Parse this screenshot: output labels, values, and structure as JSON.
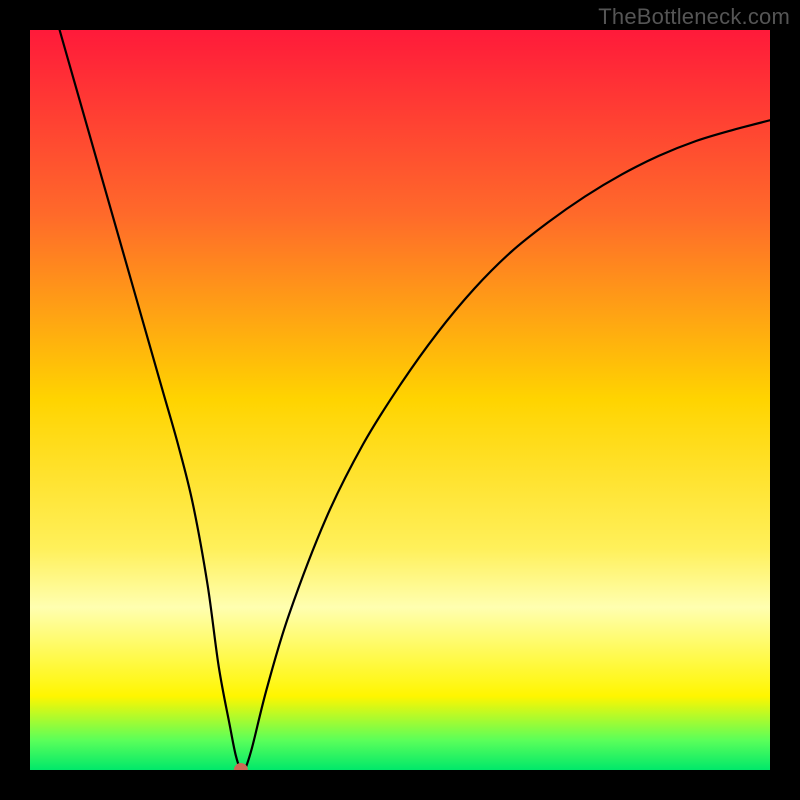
{
  "watermark": "TheBottleneck.com",
  "chart_data": {
    "type": "line",
    "title": "",
    "xlabel": "",
    "ylabel": "",
    "xlim": [
      0,
      100
    ],
    "ylim": [
      0,
      100
    ],
    "gradient_stops": [
      {
        "offset": 0,
        "color": "#ff1a3a"
      },
      {
        "offset": 0.25,
        "color": "#ff6a2a"
      },
      {
        "offset": 0.5,
        "color": "#ffd400"
      },
      {
        "offset": 0.7,
        "color": "#fff05a"
      },
      {
        "offset": 0.78,
        "color": "#ffffb0"
      },
      {
        "offset": 0.9,
        "color": "#fff600"
      },
      {
        "offset": 0.96,
        "color": "#5aff5a"
      },
      {
        "offset": 1.0,
        "color": "#00e86a"
      }
    ],
    "series": [
      {
        "name": "bottleneck-curve",
        "x": [
          4,
          6,
          8,
          10,
          12,
          14,
          16,
          18,
          20,
          22,
          24,
          25.5,
          27,
          27.8,
          28.5,
          29,
          30,
          32,
          35,
          40,
          45,
          50,
          55,
          60,
          65,
          70,
          75,
          80,
          85,
          90,
          95,
          100
        ],
        "y": [
          100,
          93,
          86,
          79,
          72,
          65,
          58,
          51,
          44,
          36,
          25,
          14,
          6,
          2,
          0,
          0,
          3,
          11,
          21,
          34,
          44,
          52,
          59,
          65,
          70,
          74,
          77.5,
          80.5,
          83,
          85,
          86.5,
          87.8
        ]
      }
    ],
    "marker": {
      "x": 28.5,
      "y": 0,
      "color": "#cc6a55",
      "radius": 7
    }
  }
}
